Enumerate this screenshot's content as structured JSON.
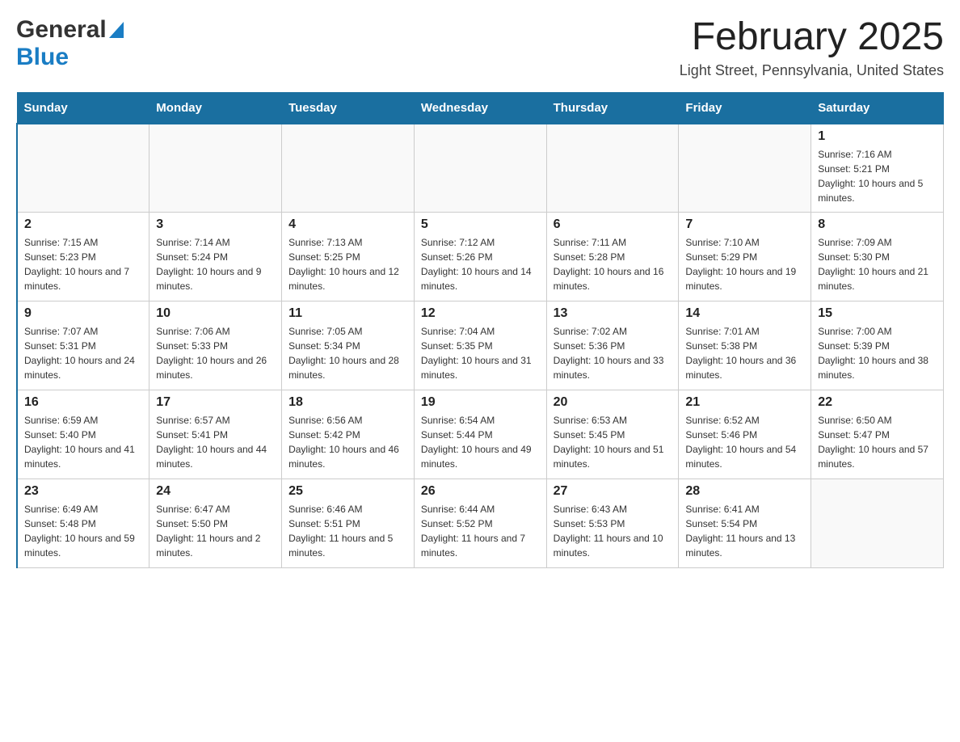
{
  "header": {
    "logo_general": "General",
    "logo_blue": "Blue",
    "month_title": "February 2025",
    "location": "Light Street, Pennsylvania, United States"
  },
  "calendar": {
    "days_of_week": [
      "Sunday",
      "Monday",
      "Tuesday",
      "Wednesday",
      "Thursday",
      "Friday",
      "Saturday"
    ],
    "weeks": [
      [
        {
          "day": "",
          "info": ""
        },
        {
          "day": "",
          "info": ""
        },
        {
          "day": "",
          "info": ""
        },
        {
          "day": "",
          "info": ""
        },
        {
          "day": "",
          "info": ""
        },
        {
          "day": "",
          "info": ""
        },
        {
          "day": "1",
          "info": "Sunrise: 7:16 AM\nSunset: 5:21 PM\nDaylight: 10 hours and 5 minutes."
        }
      ],
      [
        {
          "day": "2",
          "info": "Sunrise: 7:15 AM\nSunset: 5:23 PM\nDaylight: 10 hours and 7 minutes."
        },
        {
          "day": "3",
          "info": "Sunrise: 7:14 AM\nSunset: 5:24 PM\nDaylight: 10 hours and 9 minutes."
        },
        {
          "day": "4",
          "info": "Sunrise: 7:13 AM\nSunset: 5:25 PM\nDaylight: 10 hours and 12 minutes."
        },
        {
          "day": "5",
          "info": "Sunrise: 7:12 AM\nSunset: 5:26 PM\nDaylight: 10 hours and 14 minutes."
        },
        {
          "day": "6",
          "info": "Sunrise: 7:11 AM\nSunset: 5:28 PM\nDaylight: 10 hours and 16 minutes."
        },
        {
          "day": "7",
          "info": "Sunrise: 7:10 AM\nSunset: 5:29 PM\nDaylight: 10 hours and 19 minutes."
        },
        {
          "day": "8",
          "info": "Sunrise: 7:09 AM\nSunset: 5:30 PM\nDaylight: 10 hours and 21 minutes."
        }
      ],
      [
        {
          "day": "9",
          "info": "Sunrise: 7:07 AM\nSunset: 5:31 PM\nDaylight: 10 hours and 24 minutes."
        },
        {
          "day": "10",
          "info": "Sunrise: 7:06 AM\nSunset: 5:33 PM\nDaylight: 10 hours and 26 minutes."
        },
        {
          "day": "11",
          "info": "Sunrise: 7:05 AM\nSunset: 5:34 PM\nDaylight: 10 hours and 28 minutes."
        },
        {
          "day": "12",
          "info": "Sunrise: 7:04 AM\nSunset: 5:35 PM\nDaylight: 10 hours and 31 minutes."
        },
        {
          "day": "13",
          "info": "Sunrise: 7:02 AM\nSunset: 5:36 PM\nDaylight: 10 hours and 33 minutes."
        },
        {
          "day": "14",
          "info": "Sunrise: 7:01 AM\nSunset: 5:38 PM\nDaylight: 10 hours and 36 minutes."
        },
        {
          "day": "15",
          "info": "Sunrise: 7:00 AM\nSunset: 5:39 PM\nDaylight: 10 hours and 38 minutes."
        }
      ],
      [
        {
          "day": "16",
          "info": "Sunrise: 6:59 AM\nSunset: 5:40 PM\nDaylight: 10 hours and 41 minutes."
        },
        {
          "day": "17",
          "info": "Sunrise: 6:57 AM\nSunset: 5:41 PM\nDaylight: 10 hours and 44 minutes."
        },
        {
          "day": "18",
          "info": "Sunrise: 6:56 AM\nSunset: 5:42 PM\nDaylight: 10 hours and 46 minutes."
        },
        {
          "day": "19",
          "info": "Sunrise: 6:54 AM\nSunset: 5:44 PM\nDaylight: 10 hours and 49 minutes."
        },
        {
          "day": "20",
          "info": "Sunrise: 6:53 AM\nSunset: 5:45 PM\nDaylight: 10 hours and 51 minutes."
        },
        {
          "day": "21",
          "info": "Sunrise: 6:52 AM\nSunset: 5:46 PM\nDaylight: 10 hours and 54 minutes."
        },
        {
          "day": "22",
          "info": "Sunrise: 6:50 AM\nSunset: 5:47 PM\nDaylight: 10 hours and 57 minutes."
        }
      ],
      [
        {
          "day": "23",
          "info": "Sunrise: 6:49 AM\nSunset: 5:48 PM\nDaylight: 10 hours and 59 minutes."
        },
        {
          "day": "24",
          "info": "Sunrise: 6:47 AM\nSunset: 5:50 PM\nDaylight: 11 hours and 2 minutes."
        },
        {
          "day": "25",
          "info": "Sunrise: 6:46 AM\nSunset: 5:51 PM\nDaylight: 11 hours and 5 minutes."
        },
        {
          "day": "26",
          "info": "Sunrise: 6:44 AM\nSunset: 5:52 PM\nDaylight: 11 hours and 7 minutes."
        },
        {
          "day": "27",
          "info": "Sunrise: 6:43 AM\nSunset: 5:53 PM\nDaylight: 11 hours and 10 minutes."
        },
        {
          "day": "28",
          "info": "Sunrise: 6:41 AM\nSunset: 5:54 PM\nDaylight: 11 hours and 13 minutes."
        },
        {
          "day": "",
          "info": ""
        }
      ]
    ]
  }
}
